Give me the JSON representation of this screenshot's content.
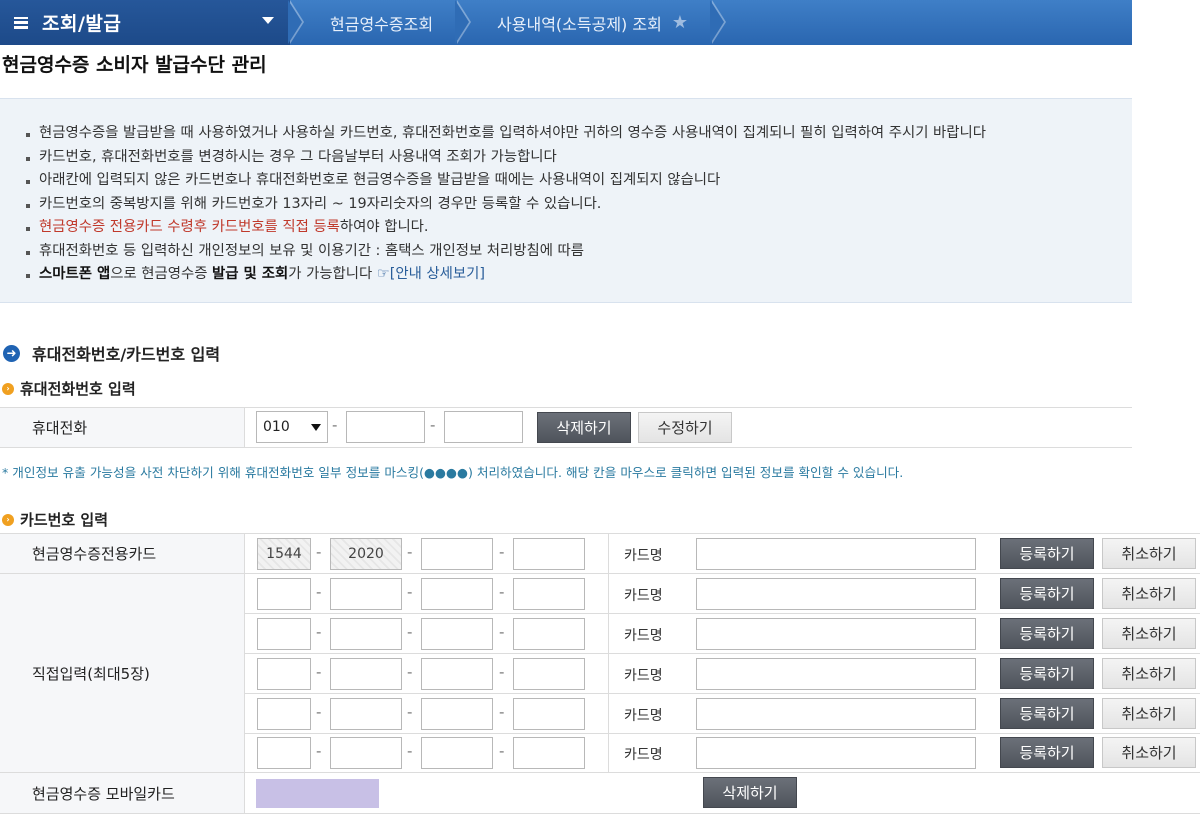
{
  "nav": {
    "menu_title": "조회/발급",
    "crumbs": [
      "현금영수증조회",
      "사용내역(소득공제) 조회"
    ]
  },
  "page_title": "현금영수증 소비자 발급수단 관리",
  "notice": {
    "items": [
      "현금영수증을 발급받을 때 사용하였거나 사용하실 카드번호, 휴대전화번호를 입력하셔야만 귀하의 영수증 사용내역이 집계되니 필히 입력하여 주시기 바랍니다",
      "카드번호, 휴대전화번호를 변경하시는 경우 그 다음날부터 사용내역 조회가 가능합니다",
      "아래칸에 입력되지 않은 카드번호나 휴대전화번호로 현금영수증을 발급받을 때에는 사용내역이 집계되지 않습니다",
      "카드번호의 중복방지를 위해 카드번호가 13자리 ~ 19자리숫자의 경우만 등록할 수 있습니다."
    ],
    "red_part": "현금영수증 전용카드 수령후 카드번호를 직접 등록",
    "red_tail": "하여야 합니다.",
    "privacy": "휴대전화번호 등 입력하신 개인정보의 보유 및 이용기간 : 홈택스 개인정보 처리방침에 따름",
    "app_b1": "스마트폰 앱",
    "app_t1": "으로 현금영수증 ",
    "app_b2": "발급 및 조회",
    "app_t2": "가 가능합니다 ",
    "app_link": "☞[안내 상세보기]"
  },
  "section_title": "휴대전화번호/카드번호 입력",
  "phone": {
    "subtitle": "휴대전화번호 입력",
    "label": "휴대전화",
    "prefix": "010",
    "delete_label": "삭제하기",
    "edit_label": "수정하기",
    "mask_note": "* 개인정보 유출 가능성을 사전 차단하기 위해 휴대전화번호 일부 정보를 마스킹(●●●●) 처리하였습니다. 해당 칸을 마우스로 클릭하면 입력된 정보를 확인할 수 있습니다."
  },
  "card": {
    "subtitle": "카드번호 입력",
    "dedicated_label": "현금영수증전용카드",
    "dedicated_part1": "1544",
    "dedicated_part2": "2020",
    "direct_label": "직접입력(최대5장)",
    "card_name_label": "카드명",
    "register_label": "등록하기",
    "cancel_label": "취소하기",
    "mobile_label": "현금영수증 모바일카드",
    "mobile_delete_label": "삭제하기"
  },
  "colors": {
    "nav_blue": "#2a66b0",
    "notice_red": "#c0392b",
    "mobile_swatch": "#c8c0e6"
  }
}
